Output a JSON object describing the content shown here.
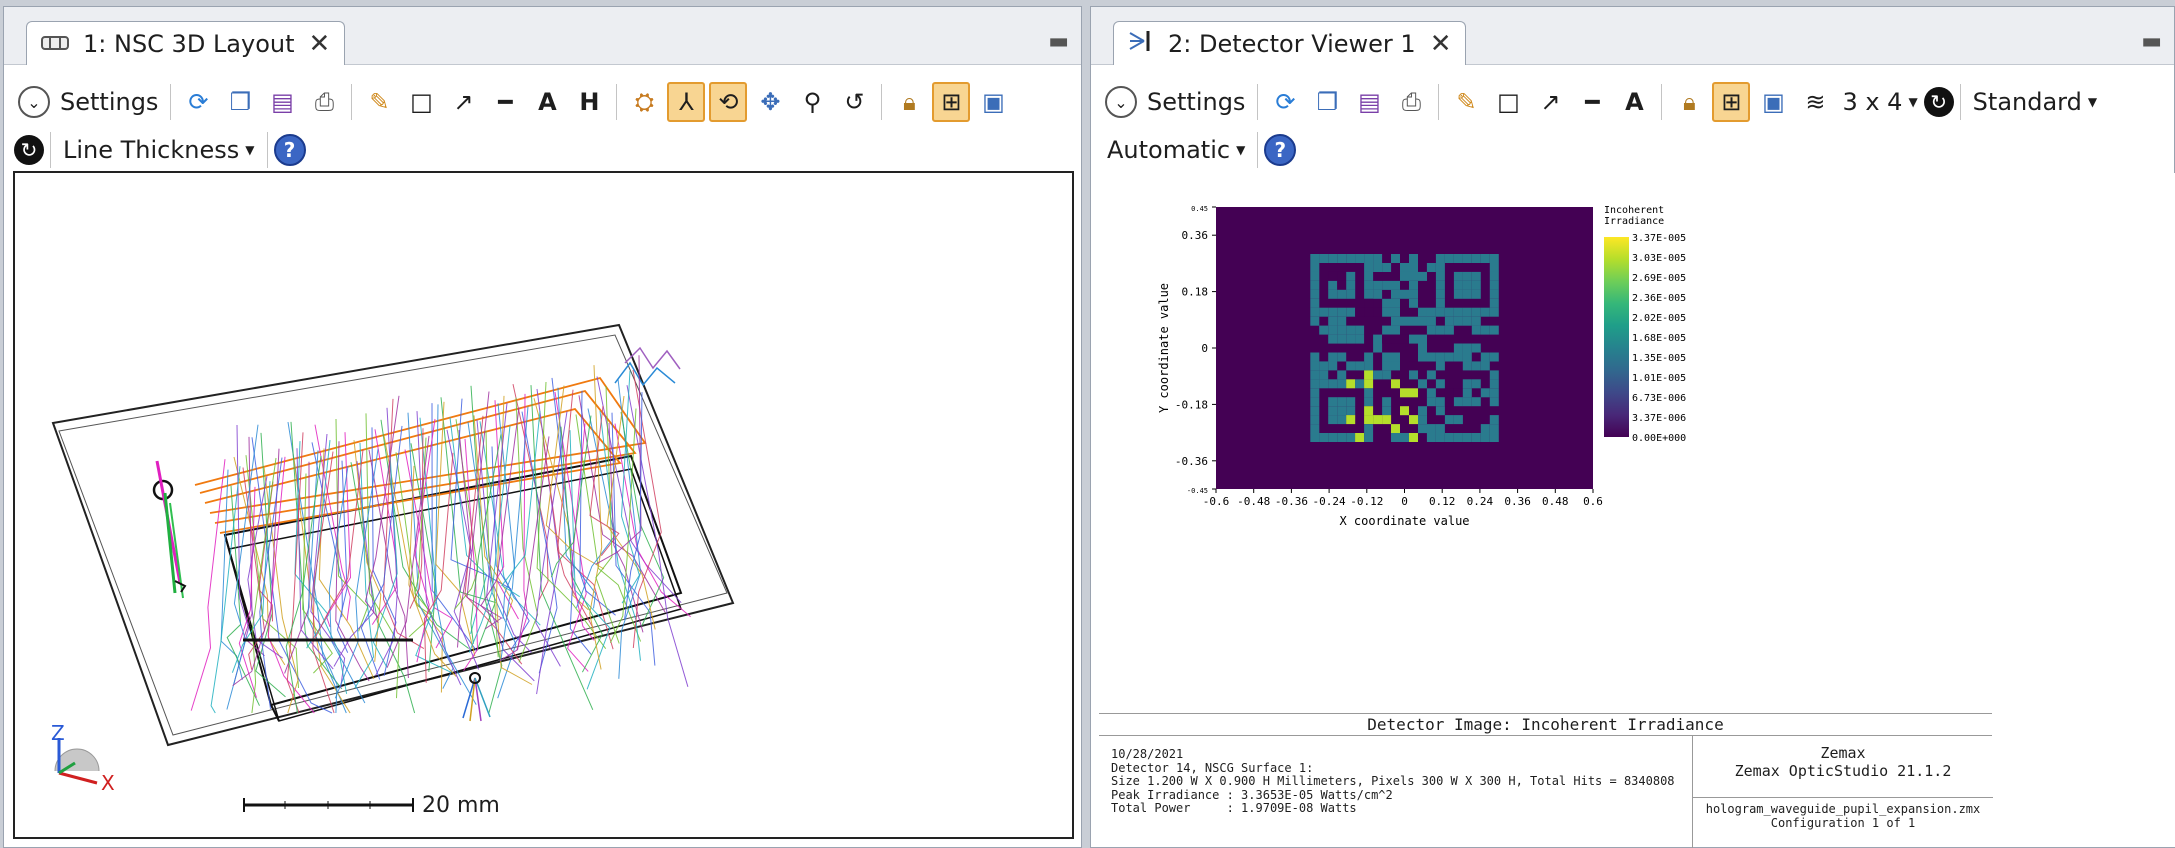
{
  "left": {
    "tab": {
      "title": "1: NSC 3D Layout"
    },
    "toolbar": {
      "settings": "Settings",
      "line_thickness": "Line Thickness"
    },
    "scale_label": "20 mm",
    "axes": {
      "z": "Z",
      "y": "Y",
      "x": "X"
    }
  },
  "right": {
    "tab": {
      "title": "2: Detector Viewer 1"
    },
    "toolbar": {
      "settings": "Settings",
      "grid": "3 x 4",
      "display": "Standard",
      "scale_mode": "Automatic"
    },
    "chart_data": {
      "type": "heatmap",
      "title": "Detector Image: Incoherent Irradiance",
      "xlabel": "X coordinate value",
      "ylabel": "Y coordinate value",
      "xlim": [
        -0.6,
        0.6
      ],
      "ylim": [
        -0.45,
        0.45
      ],
      "xticks": [
        "-0.6",
        "-0.48",
        "-0.36",
        "-0.24",
        "-0.12",
        "0",
        "0.12",
        "0.24",
        "0.36",
        "0.48",
        "0.6"
      ],
      "yticks": [
        "0.45",
        "0.36",
        "0.18",
        "0",
        "-0.18",
        "-0.36",
        "-0.45"
      ],
      "colorbar_title": [
        "Incoherent",
        "Irradiance"
      ],
      "colorbar_labels": [
        "3.37E-005",
        "3.03E-005",
        "2.69E-005",
        "2.36E-005",
        "2.02E-005",
        "1.68E-005",
        "1.35E-005",
        "1.01E-005",
        "6.73E-006",
        "3.37E-006",
        "0.00E+000"
      ],
      "colormap": [
        "#fde725",
        "#b5de2b",
        "#6ece58",
        "#35b779",
        "#1f9e89",
        "#26828e",
        "#31688e",
        "#3e4989",
        "#482878",
        "#440154"
      ],
      "background_color": "#440154",
      "pattern_color": "#2a7b8e",
      "bright_color": "#b5de2b"
    },
    "footer": {
      "title": "Detector Image: Incoherent Irradiance",
      "date": "10/28/2021",
      "lines": [
        "Detector 14, NSCG Surface 1:",
        "Size 1.200 W X 0.900 H Millimeters, Pixels 300 W X 300 H, Total Hits = 8340808",
        "Peak Irradiance : 3.3653E-05 Watts/cm^2",
        "Total Power     : 1.9709E-08 Watts"
      ],
      "company": "Zemax",
      "product": "Zemax OpticStudio 21.1.2",
      "file": "hologram_waveguide_pupil_expansion.zmx",
      "config": "Configuration 1 of 1"
    }
  }
}
